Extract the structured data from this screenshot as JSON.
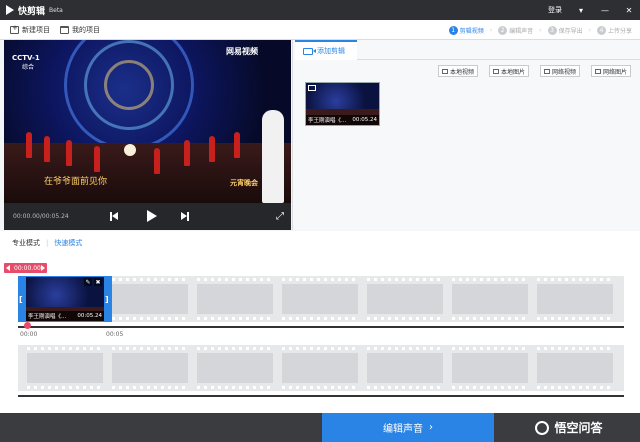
{
  "app": {
    "name": "快剪辑",
    "badge": "Beta"
  },
  "titlebar": {
    "login": "登录",
    "menu_glyph": "▾",
    "min_glyph": "—",
    "close_glyph": "✕"
  },
  "toolbar": {
    "new_project": "新建项目",
    "my_projects": "我的项目",
    "steps": [
      {
        "num": "1",
        "label": "剪辑视频",
        "active": true
      },
      {
        "num": "2",
        "label": "编辑声音"
      },
      {
        "num": "3",
        "label": "保存导出"
      },
      {
        "num": "4",
        "label": "上传分享"
      }
    ]
  },
  "preview": {
    "watermark_left": "CCTV-1",
    "watermark_left_sub": "综合",
    "watermark_right": "网易视频",
    "subtitle": "在爷爷面前见你",
    "overlay_right": "元宵晚会",
    "time_current": "00:00.00",
    "time_total": "00:05.24",
    "time_separator": "/",
    "fullscreen_glyph": "⤢"
  },
  "right_panel": {
    "tab_label": "添加剪辑",
    "buttons": [
      "本地视频",
      "本地图片",
      "网络视频",
      "网络图片"
    ],
    "clip": {
      "title": "李王刚演唱《...",
      "duration": "00:05.24"
    }
  },
  "modes": {
    "pro": "专业模式",
    "separator": "|",
    "quick": "快速模式"
  },
  "timeline": {
    "timecode": "00:00.00",
    "clip": {
      "title": "李王刚演唱《...",
      "duration": "00:05.24",
      "left_handle": "[",
      "right_handle": "]",
      "edit_glyph": "✎",
      "delete_glyph": "✖"
    },
    "ticks": [
      "00:00",
      "00:05"
    ]
  },
  "bottom": {
    "next_label": "编辑声音",
    "next_arrow": "›",
    "corner_logo": "悟空问答"
  }
}
